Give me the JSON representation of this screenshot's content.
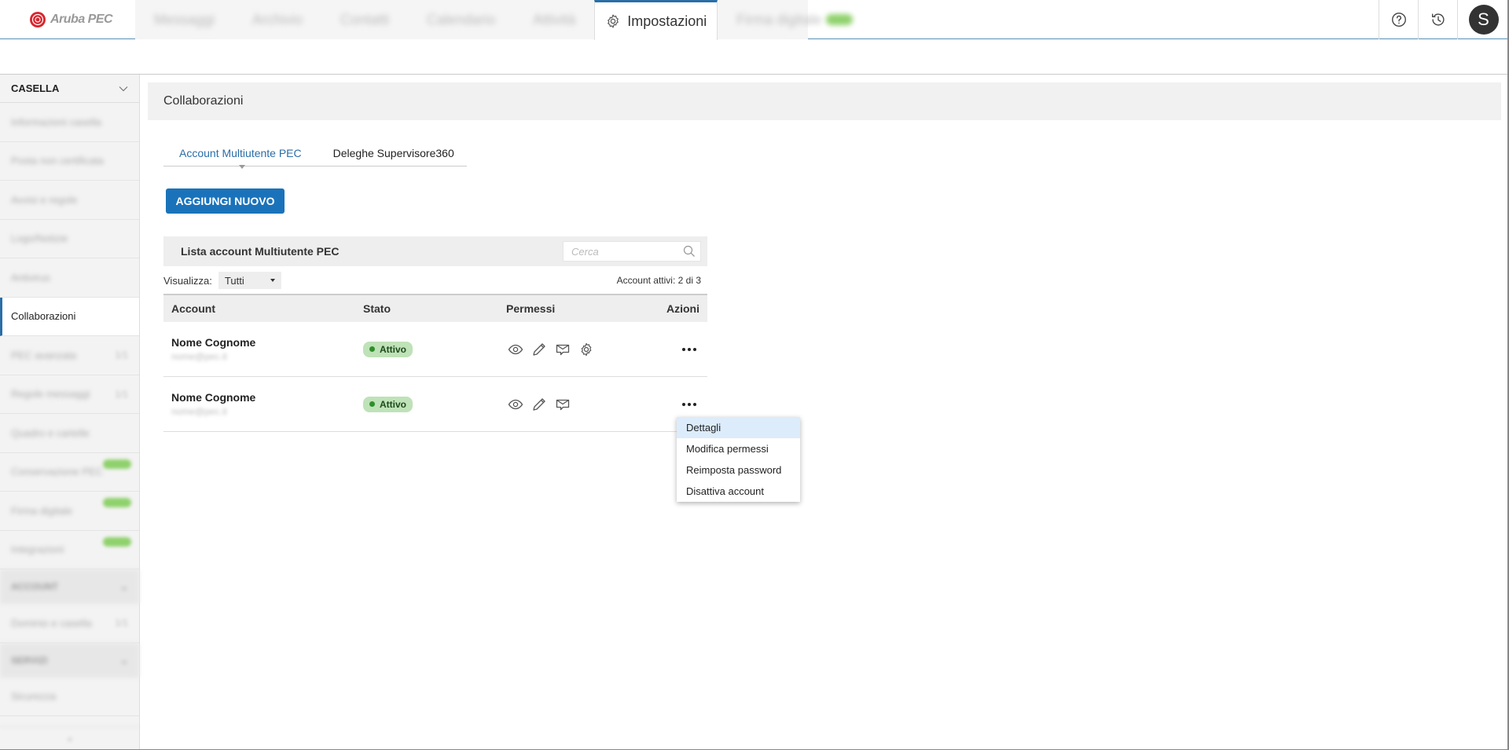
{
  "brand": {
    "name": "Aruba PEC"
  },
  "nav": {
    "tabs": [
      {
        "label": "Messaggi"
      },
      {
        "label": "Archivio"
      },
      {
        "label": "Contatti"
      },
      {
        "label": "Calendario"
      },
      {
        "label": "Attività"
      },
      {
        "label": "Impostazioni"
      },
      {
        "label": "Firma digitale"
      }
    ]
  },
  "user": {
    "initial": "S"
  },
  "sidebar": {
    "header": "CASELLA",
    "items": [
      {
        "label": "Informazioni casella"
      },
      {
        "label": "Posta non certificata"
      },
      {
        "label": "Avvisi e regole"
      },
      {
        "label": "Logo/Notizie"
      },
      {
        "label": "Antivirus"
      },
      {
        "label": "Collaborazioni"
      },
      {
        "label": "PEC avanzata",
        "count": "1/1"
      },
      {
        "label": "Regole messaggi",
        "count": "1/1"
      },
      {
        "label": "Quadro e cartelle"
      },
      {
        "label": "Conservazione PEC"
      },
      {
        "label": "Firma digitale"
      },
      {
        "label": "Integrazioni"
      }
    ],
    "sections": [
      {
        "label": "ACCOUNT"
      },
      {
        "label": "Dominio e casella",
        "count": "1/1"
      },
      {
        "label": "SERVIZI"
      },
      {
        "label": "Sicurezza"
      }
    ]
  },
  "page": {
    "title": "Collaborazioni"
  },
  "subtabs": [
    {
      "label": "Account Multiutente PEC"
    },
    {
      "label": "Deleghe Supervisore360"
    }
  ],
  "actions": {
    "add_label": "AGGIUNGI NUOVO"
  },
  "list": {
    "title": "Lista account Multiutente PEC",
    "search_placeholder": "Cerca",
    "filter_label": "Visualizza:",
    "filter_value": "Tutti",
    "count_text": "Account attivi: 2 di 3",
    "columns": {
      "account": "Account",
      "stato": "Stato",
      "permessi": "Permessi",
      "azioni": "Azioni"
    },
    "rows": [
      {
        "name": "Nome Cognome",
        "email": "nome@pec.it",
        "status": "Attivo",
        "permissions": [
          "eye-icon",
          "pencil-icon",
          "mail-icon",
          "gear-icon"
        ]
      },
      {
        "name": "Nome Cognome",
        "email": "nome@pec.it",
        "status": "Attivo",
        "permissions": [
          "eye-icon",
          "pencil-icon",
          "mail-icon"
        ]
      }
    ]
  },
  "context_menu": {
    "items": [
      {
        "label": "Dettagli"
      },
      {
        "label": "Modifica permessi"
      },
      {
        "label": "Reimposta password"
      },
      {
        "label": "Disattiva account"
      }
    ]
  },
  "colors": {
    "accent": "#1a73ba",
    "active_badge": "#bfe2b8",
    "active_dot": "#2f8f2a"
  }
}
